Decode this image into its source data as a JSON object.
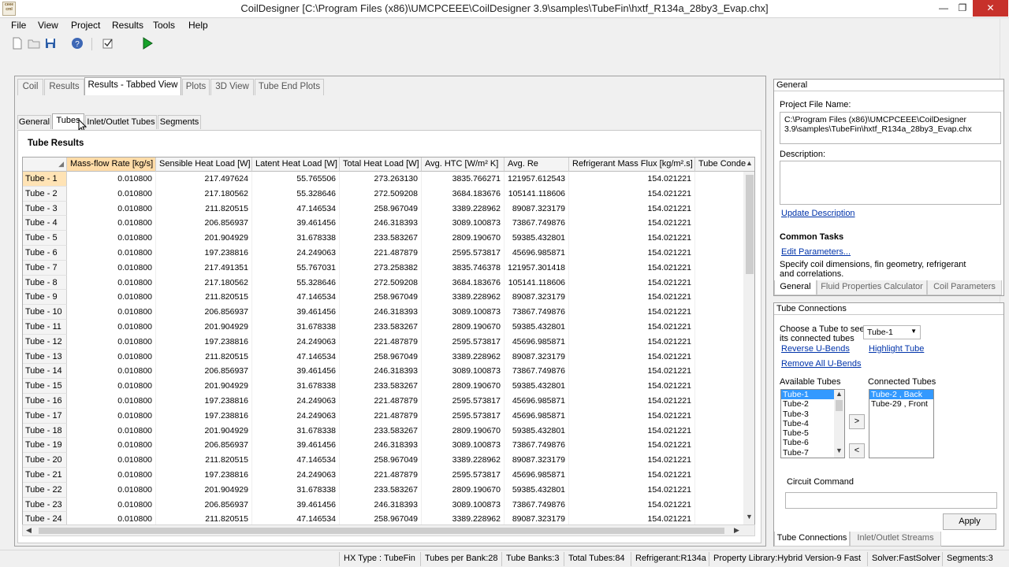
{
  "window": {
    "title": "CoilDesigner [C:\\Program Files (x86)\\UMCPCEEE\\CoilDesigner 3.9\\samples\\TubeFin\\hxtf_R134a_28by3_Evap.chx]",
    "logo_text": "ceee cml"
  },
  "menu": [
    "File",
    "View",
    "Project",
    "Results",
    "Tools",
    "Help"
  ],
  "main_tabs": [
    "Coil",
    "Results",
    "Results - Tabbed View",
    "Plots",
    "3D View",
    "Tube End Plots"
  ],
  "sub_tabs": [
    "General",
    "Tubes",
    "Inlet/Outlet Tubes",
    "Segments"
  ],
  "section_title": "Tube Results",
  "table": {
    "columns": [
      "Mass-flow Rate [kg/s]",
      "Sensible Heat Load [W]",
      "Latent Heat Load [W]",
      "Total Heat Load [W]",
      "Avg. HTC [W/m² K]",
      "Avg. Re",
      "Refrigerant Mass Flux [kg/m².s]",
      "Tube Conde"
    ],
    "rows": [
      [
        "Tube - 1",
        "0.010800",
        "217.497624",
        "55.765506",
        "273.263130",
        "3835.766271",
        "121957.612543",
        "154.021221"
      ],
      [
        "Tube - 2",
        "0.010800",
        "217.180562",
        "55.328646",
        "272.509208",
        "3684.183676",
        "105141.118606",
        "154.021221"
      ],
      [
        "Tube - 3",
        "0.010800",
        "211.820515",
        "47.146534",
        "258.967049",
        "3389.228962",
        "89087.323179",
        "154.021221"
      ],
      [
        "Tube - 4",
        "0.010800",
        "206.856937",
        "39.461456",
        "246.318393",
        "3089.100873",
        "73867.749876",
        "154.021221"
      ],
      [
        "Tube - 5",
        "0.010800",
        "201.904929",
        "31.678338",
        "233.583267",
        "2809.190670",
        "59385.432801",
        "154.021221"
      ],
      [
        "Tube - 6",
        "0.010800",
        "197.238816",
        "24.249063",
        "221.487879",
        "2595.573817",
        "45696.985871",
        "154.021221"
      ],
      [
        "Tube - 7",
        "0.010800",
        "217.491351",
        "55.767031",
        "273.258382",
        "3835.746378",
        "121957.301418",
        "154.021221"
      ],
      [
        "Tube - 8",
        "0.010800",
        "217.180562",
        "55.328646",
        "272.509208",
        "3684.183676",
        "105141.118606",
        "154.021221"
      ],
      [
        "Tube - 9",
        "0.010800",
        "211.820515",
        "47.146534",
        "258.967049",
        "3389.228962",
        "89087.323179",
        "154.021221"
      ],
      [
        "Tube - 10",
        "0.010800",
        "206.856937",
        "39.461456",
        "246.318393",
        "3089.100873",
        "73867.749876",
        "154.021221"
      ],
      [
        "Tube - 11",
        "0.010800",
        "201.904929",
        "31.678338",
        "233.583267",
        "2809.190670",
        "59385.432801",
        "154.021221"
      ],
      [
        "Tube - 12",
        "0.010800",
        "197.238816",
        "24.249063",
        "221.487879",
        "2595.573817",
        "45696.985871",
        "154.021221"
      ],
      [
        "Tube - 13",
        "0.010800",
        "211.820515",
        "47.146534",
        "258.967049",
        "3389.228962",
        "89087.323179",
        "154.021221"
      ],
      [
        "Tube - 14",
        "0.010800",
        "206.856937",
        "39.461456",
        "246.318393",
        "3089.100873",
        "73867.749876",
        "154.021221"
      ],
      [
        "Tube - 15",
        "0.010800",
        "201.904929",
        "31.678338",
        "233.583267",
        "2809.190670",
        "59385.432801",
        "154.021221"
      ],
      [
        "Tube - 16",
        "0.010800",
        "197.238816",
        "24.249063",
        "221.487879",
        "2595.573817",
        "45696.985871",
        "154.021221"
      ],
      [
        "Tube - 17",
        "0.010800",
        "197.238816",
        "24.249063",
        "221.487879",
        "2595.573817",
        "45696.985871",
        "154.021221"
      ],
      [
        "Tube - 18",
        "0.010800",
        "201.904929",
        "31.678338",
        "233.583267",
        "2809.190670",
        "59385.432801",
        "154.021221"
      ],
      [
        "Tube - 19",
        "0.010800",
        "206.856937",
        "39.461456",
        "246.318393",
        "3089.100873",
        "73867.749876",
        "154.021221"
      ],
      [
        "Tube - 20",
        "0.010800",
        "211.820515",
        "47.146534",
        "258.967049",
        "3389.228962",
        "89087.323179",
        "154.021221"
      ],
      [
        "Tube - 21",
        "0.010800",
        "197.238816",
        "24.249063",
        "221.487879",
        "2595.573817",
        "45696.985871",
        "154.021221"
      ],
      [
        "Tube - 22",
        "0.010800",
        "201.904929",
        "31.678338",
        "233.583267",
        "2809.190670",
        "59385.432801",
        "154.021221"
      ],
      [
        "Tube - 23",
        "0.010800",
        "206.856937",
        "39.461456",
        "246.318393",
        "3089.100873",
        "73867.749876",
        "154.021221"
      ],
      [
        "Tube - 24",
        "0.010800",
        "211.820515",
        "47.146534",
        "258.967049",
        "3389.228962",
        "89087.323179",
        "154.021221"
      ]
    ]
  },
  "general_panel": {
    "title": "General",
    "project_file_label": "Project File Name:",
    "project_file_value": "C:\\Program Files (x86)\\UMCPCEEE\\CoilDesigner 3.9\\samples\\TubeFin\\hxtf_R134a_28by3_Evap.chx",
    "description_label": "Description:",
    "description_value": "",
    "update_description": "Update Description",
    "common_tasks": "Common Tasks",
    "edit_parameters": "Edit Parameters...",
    "edit_parameters_desc": "Specify coil dimensions, fin geometry, refrigerant and correlations.",
    "tabs": [
      "General",
      "Fluid Properties Calculator",
      "Coil Parameters"
    ]
  },
  "tube_panel": {
    "title": "Tube Connections",
    "choose_label": "Choose a Tube to see its connected tubes",
    "selected_tube": "Tube-1",
    "reverse_ubends": "Reverse U-Bends",
    "highlight_tube": "Highlight Tube",
    "remove_ubends": "Remove All U-Bends",
    "available_label": "Available Tubes",
    "connected_label": "Connected Tubes",
    "available_tubes": [
      "Tube-1",
      "Tube-2",
      "Tube-3",
      "Tube-4",
      "Tube-5",
      "Tube-6",
      "Tube-7"
    ],
    "connected_tubes": [
      "Tube-2 , Back",
      "Tube-29 , Front"
    ],
    "add_btn": ">",
    "remove_btn": "<",
    "circuit_command_label": "Circuit Command",
    "circuit_command_value": "",
    "apply": "Apply",
    "tabs": [
      "Tube Connections",
      "Inlet/Outlet Streams"
    ]
  },
  "status_bar": [
    "HX Type : TubeFin",
    "Tubes per Bank:28",
    "Tube Banks:3",
    "Total Tubes:84",
    "Refrigerant:R134a",
    "Property Library:Hybrid Version-9 Fast",
    "Solver:FastSolver",
    "Segments:3"
  ],
  "colors": {
    "selected_header": "#ffdca8",
    "close_button": "#c7312b",
    "link": "#0033aa",
    "selection": "#3399ff"
  }
}
